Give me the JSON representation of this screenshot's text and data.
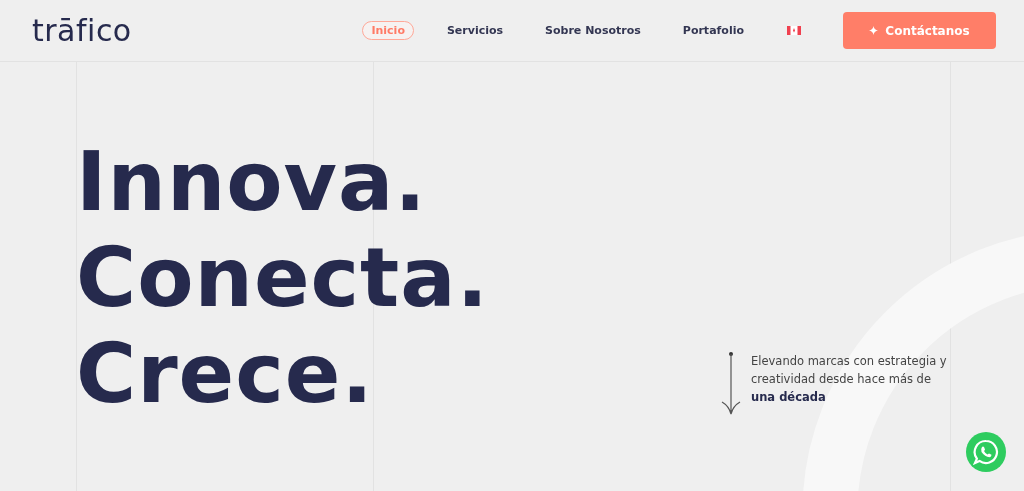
{
  "logo": "trāfico",
  "nav": [
    {
      "label": "Inicio",
      "selected": true
    },
    {
      "label": "Servicios",
      "selected": false
    },
    {
      "label": "Sobre Nosotros",
      "selected": false
    },
    {
      "label": "Portafolio",
      "selected": false
    }
  ],
  "contact_button": "Contáctanos",
  "headline": [
    "Innova.",
    "Conecta.",
    "Crece."
  ],
  "tagline": "Elevando marcas con estrategia y creatividad desde hace más de **una década**"
}
